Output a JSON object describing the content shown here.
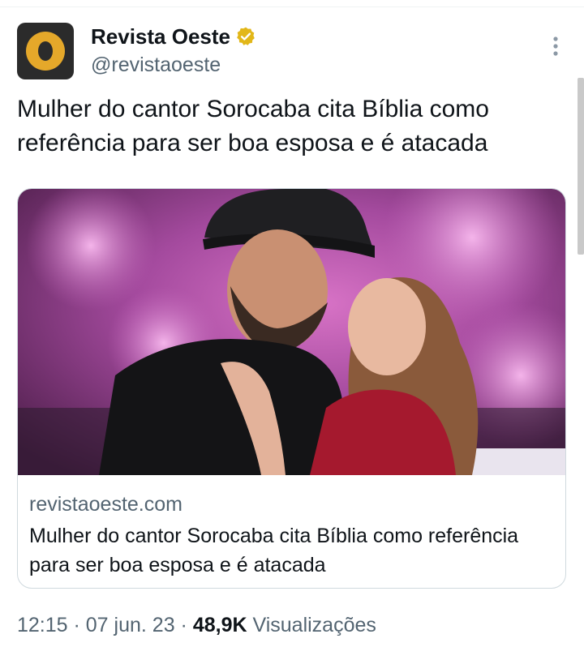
{
  "author": {
    "display_name": "Revista Oeste",
    "handle": "@revistaoeste",
    "verified_icon": "verified-badge-icon",
    "verified_color": "#e2b719"
  },
  "tweet": {
    "text": "Mulher do cantor Sorocaba cita Bíblia como referência para ser boa esposa e é atacada"
  },
  "link_card": {
    "domain": "revistaoeste.com",
    "title": "Mulher do cantor Sorocaba cita Bíblia como referência para ser boa esposa e é atacada"
  },
  "meta": {
    "time": "12:15",
    "sep1": " · ",
    "date": "07 jun. 23",
    "sep2": " · ",
    "views_count": "48,9K",
    "views_label": " Visualizações"
  },
  "colors": {
    "text_primary": "#0f1419",
    "text_secondary": "#536471",
    "border": "#cfd9de",
    "avatar_bg": "#2b2b2b",
    "avatar_accent": "#e5a82a"
  }
}
